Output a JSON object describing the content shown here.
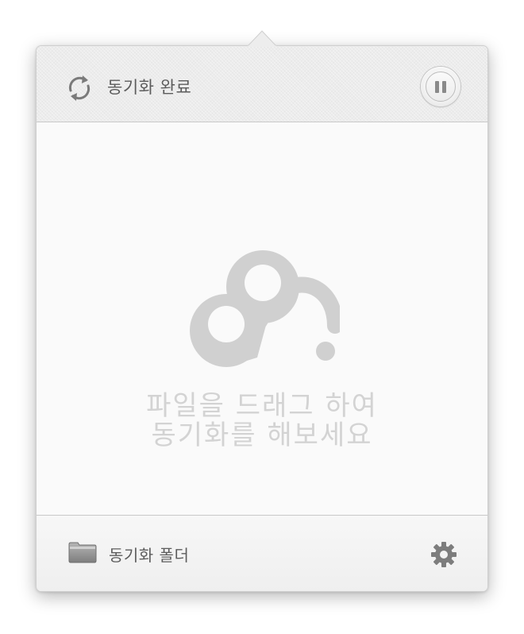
{
  "header": {
    "status_text": "동기화 완료",
    "sync_icon": "sync-arrows-icon",
    "pause_button_icon": "pause-icon"
  },
  "dropzone": {
    "logo_icon": "cloud-sync-logo-icon",
    "line1": "파일을 드래그 하여",
    "line2": "동기화를 해보세요"
  },
  "footer": {
    "folder_label": "동기화 폴더",
    "folder_icon": "folder-icon",
    "settings_icon": "gear-icon"
  },
  "colors": {
    "logo": "#d0d0d0",
    "drop_text": "#d3d3d3",
    "label_text": "#5c5c5c"
  }
}
